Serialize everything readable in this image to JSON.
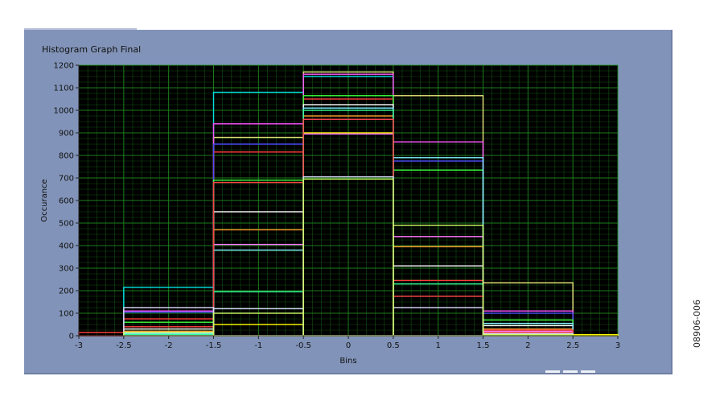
{
  "window": {
    "title": "Histogram Graph Final"
  },
  "figure_id": "08906-006",
  "chart_data": {
    "type": "histogram",
    "title": "Histogram Graph Final",
    "xlabel": "Bins",
    "ylabel": "Occurance",
    "xlim": [
      -3,
      3
    ],
    "ylim": [
      0,
      1200
    ],
    "x_ticks": [
      -3,
      -2.5,
      -2,
      -1.5,
      -1,
      -0.5,
      0,
      0.5,
      1,
      1.5,
      2,
      2.5,
      3
    ],
    "y_ticks": [
      0,
      100,
      200,
      300,
      400,
      500,
      600,
      700,
      800,
      900,
      1000,
      1100,
      1200
    ],
    "x_tick_labels": [
      "-3",
      "-2.5",
      "-2",
      "-1.5",
      "-1",
      "-0.5",
      "0",
      "0.5",
      "1",
      "1.5",
      "2",
      "2.5",
      "3"
    ],
    "y_tick_labels": [
      "0",
      "100",
      "200",
      "300",
      "400",
      "500",
      "600",
      "700",
      "800",
      "900",
      "1000",
      "1100",
      "1200"
    ],
    "grid": true,
    "background": "#000000",
    "grid_color": "#1f8a1f",
    "bin_edges": [
      -3,
      -2.5,
      -1.5,
      -0.5,
      0.5,
      1.5,
      2.5,
      3
    ],
    "series": [
      {
        "color": "#00e5e5",
        "values": [
          0,
          215,
          1080,
          1150,
          0,
          0,
          0
        ]
      },
      {
        "color": "#e9e97a",
        "values": [
          0,
          0,
          880,
          1170,
          1065,
          235,
          0
        ]
      },
      {
        "color": "#ff55ff",
        "values": [
          0,
          110,
          940,
          1160,
          860,
          110,
          0
        ]
      },
      {
        "color": "#ff3b3b",
        "values": [
          15,
          75,
          815,
          1050,
          245,
          15,
          0
        ]
      },
      {
        "color": "#4d4dff",
        "values": [
          0,
          105,
          850,
          960,
          775,
          100,
          0
        ]
      },
      {
        "color": "#3cff3c",
        "values": [
          0,
          60,
          690,
          1065,
          735,
          70,
          0
        ]
      },
      {
        "color": "#ffffff",
        "values": [
          0,
          30,
          550,
          1025,
          310,
          45,
          0
        ]
      },
      {
        "color": "#ffa030",
        "values": [
          0,
          20,
          470,
          975,
          395,
          30,
          0
        ]
      },
      {
        "color": "#ffff00",
        "values": [
          0,
          5,
          50,
          900,
          0,
          0,
          5
        ]
      },
      {
        "color": "#ff77ff",
        "values": [
          0,
          15,
          405,
          895,
          440,
          20,
          0
        ]
      },
      {
        "color": "#7ff0ff",
        "values": [
          0,
          10,
          380,
          1010,
          790,
          55,
          0
        ]
      },
      {
        "color": "#33ff99",
        "values": [
          0,
          5,
          195,
          1000,
          230,
          10,
          0
        ]
      },
      {
        "color": "#ff4444",
        "values": [
          0,
          40,
          680,
          960,
          175,
          25,
          0
        ]
      },
      {
        "color": "#ddddff",
        "values": [
          0,
          125,
          120,
          705,
          125,
          10,
          0
        ]
      },
      {
        "color": "#ccff66",
        "values": [
          0,
          15,
          100,
          695,
          490,
          5,
          0
        ]
      }
    ]
  }
}
